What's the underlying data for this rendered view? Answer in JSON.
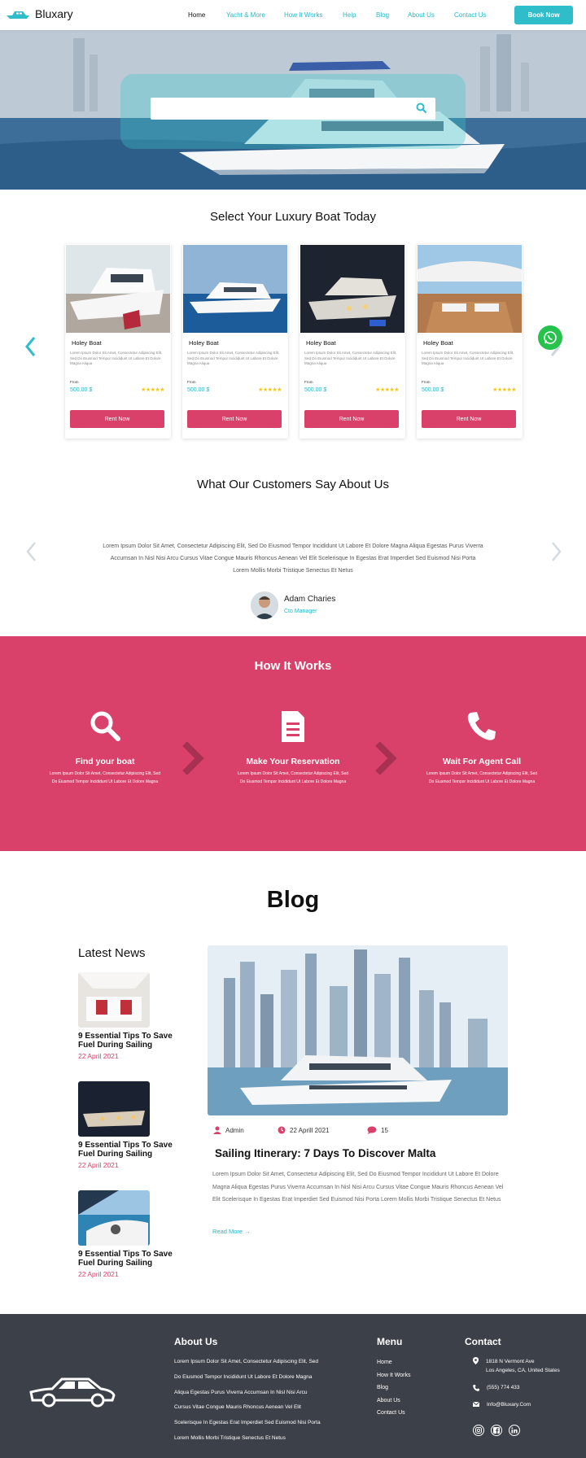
{
  "header": {
    "brand": "Bluxary",
    "nav": [
      {
        "label": "Home",
        "active": true
      },
      {
        "label": "Yacht & More"
      },
      {
        "label": "How It Works"
      },
      {
        "label": "Help"
      },
      {
        "label": "Blog"
      },
      {
        "label": "About Us"
      },
      {
        "label": "Contact Us"
      }
    ],
    "cta": "Book Now"
  },
  "hero": {
    "search_placeholder": "",
    "search_icon": "search-icon"
  },
  "boats": {
    "title": "Select Your Luxury Boat Today",
    "cards": [
      {
        "name": "Holey Boat",
        "desc": "Lorem Ipsum Dolor Sit Amet, Consectetur Adipiscing Elit, Sed Do Eiusmod Tempor Incididunt Ut Labore Et Dolore Magna Aliqua",
        "from": "From",
        "price": "500.00 $",
        "rating": 5,
        "button": "Rent Now"
      },
      {
        "name": "Holey Boat",
        "desc": "Lorem Ipsum Dolor Sit Amet, Consectetur Adipiscing Elit, Sed Do Eiusmod Tempor Incididunt Ut Labore Et Dolore Magna Aliqua",
        "from": "From",
        "price": "500.00 $",
        "rating": 5,
        "button": "Rent Now"
      },
      {
        "name": "Holey Boat",
        "desc": "Lorem Ipsum Dolor Sit Amet, Consectetur Adipiscing Elit, Sed Do Eiusmod Tempor Incididunt Ut Labore Et Dolore Magna Aliqua",
        "from": "From",
        "price": "500.00 $",
        "rating": 5,
        "button": "Rent Now"
      },
      {
        "name": "Holey Boat",
        "desc": "Lorem Ipsum Dolor Sit Amet, Consectetur Adipiscing Elit, Sed Do Eiusmod Tempor Incididunt Ut Labore Et Dolore Magna Aliqua",
        "from": "From",
        "price": "500.00 $",
        "rating": 5,
        "button": "Rent Now"
      }
    ]
  },
  "testimonials": {
    "title": "What Our Customers Say About Us",
    "quote": "Lorem Ipsum Dolor Sit Amet, Consectetur Adipiscing Elit, Sed Do Eiusmod Tempor Incididunt Ut Labore Et Dolore Magna Aliqua Egestas Purus Viverra Accumsan In Nisl Nisi Arcu Cursus Vitae Congue Mauris Rhoncus Aenean Vel Elit Scelerisque In Egestas Erat Imperdiet Sed Euismod Nisi Porta Lorem Mollis Morbi Tristique Senectus Et Netus",
    "name": "Adam Charies",
    "role": "Cto Manager"
  },
  "how": {
    "title": "How It Works",
    "steps": [
      {
        "title": "Find your boat",
        "desc": "Lorem Ipsum Dolor Sit Amet, Consectetur Adipiscing Elit, Sed Do Eiusmod Tempor Incididunt Ut Labore Et Dolore Magna",
        "icon": "search-icon"
      },
      {
        "title": "Make Your Reservation",
        "desc": "Lorem Ipsum Dolor Sit Amet, Consectetur Adipiscing Elit, Sed Do Eiusmod Tempor Incididunt Ut Labore Et Dolore Magna",
        "icon": "document-icon"
      },
      {
        "title": "Wait For Agent Call",
        "desc": "Lorem Ipsum Dolor Sit Amet, Consectetur Adipiscing Elit, Sed Do Eiusmod Tempor Incididunt Ut Labore Et Dolore Magna",
        "icon": "phone-icon"
      }
    ]
  },
  "blog": {
    "title": "Blog",
    "latest_title": "Latest News",
    "latest": [
      {
        "title": "9 Essential Tips To Save Fuel During Sailing",
        "date": "22 April 2021"
      },
      {
        "title": "9 Essential Tips To Save Fuel During Sailing",
        "date": "22 April 2021"
      },
      {
        "title": "9 Essential Tips To Save Fuel During Sailing",
        "date": "22 April 2021"
      }
    ],
    "post": {
      "author": "Admin",
      "date": "22 Aprill 2021",
      "comments": "15",
      "title": "Sailing Itinerary: 7 Days To Discover Malta",
      "body": "Lorem Ipsum Dolor Sit Amet, Consectetur Adipiscing Elit, Sed Do Eiusmod Tempor Incididunt Ut Labore Et Dolore Magna Aliqua Egestas Purus Viverra Accumsan In Nisl Nisi Arcu Cursus Vitae Congue Mauris Rhoncus Aenean Vel Elit Scelerisque In Egestas Erat Imperdiet Sed Euismod Nisi Porta Lorem Mollis Morbi Tristique Senectus Et Netus",
      "read_more": "Read More"
    }
  },
  "footer": {
    "about_title": "About Us",
    "about_lines": [
      "Lorem Ipsum Dolor Sit Amet, Consectetur Adipiscing Elit, Sed",
      "Do Eiusmod Tempor Incididunt Ut Labore Et Dolore Magna",
      "Aliqua Egestas Purus Viverra Accumsan In Nisl Nisi Arcu",
      "Cursus Vitae Congue Mauris Rhoncus Aenean Vel Elit",
      "Scelerisque In Egestas Erat Imperdiet Sed Euismod Nisi Porta",
      "Lorem Mollis Morbi Tristique Senectus Et Netus"
    ],
    "menu_title": "Menu",
    "menu": [
      "Home",
      "How It Works",
      "Blog",
      "About Us",
      "Contact Us"
    ],
    "contact_title": "Contact",
    "address_1": "1818 N Vermont Ave",
    "address_2": "Los Angeles, CA, United States",
    "phone": "(555) 774 433",
    "email": "Info@Bluxary.Com",
    "socials": [
      "instagram-icon",
      "facebook-icon",
      "linkedin-icon"
    ]
  },
  "colors": {
    "accent": "#2fbdc9",
    "primary_pink": "#d9416a",
    "footer_bg": "#3c4049",
    "whatsapp": "#27c24c"
  }
}
